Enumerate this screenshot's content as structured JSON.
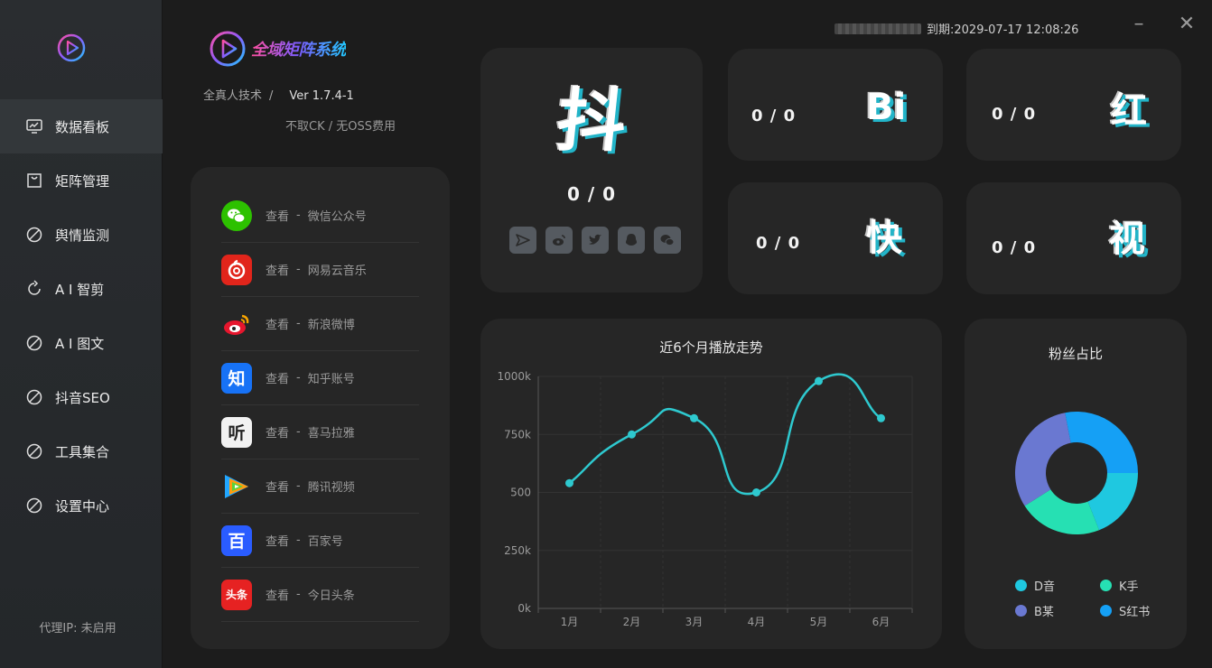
{
  "header": {
    "app_title": "全域矩阵系统",
    "breadcrumb": "全真人技术",
    "breadcrumb_sep": "/",
    "version": "Ver 1.7.4-1",
    "note": "不取CK / 无OSS费用",
    "expire": "到期:2029-07-17 12:08:26",
    "minimize": "–",
    "close": "✕"
  },
  "sidebar": {
    "items": [
      {
        "label": "数据看板",
        "icon": "monitor-chart-icon"
      },
      {
        "label": "矩阵管理",
        "icon": "shopping-bag-icon"
      },
      {
        "label": "舆情监测",
        "icon": "ban-circle-icon"
      },
      {
        "label": "A I 智剪",
        "icon": "refresh-icon"
      },
      {
        "label": "A I 图文",
        "icon": "ban-circle-icon"
      },
      {
        "label": "抖音SEO",
        "icon": "ban-circle-icon"
      },
      {
        "label": "工具集合",
        "icon": "ban-circle-icon"
      },
      {
        "label": "设置中心",
        "icon": "ban-circle-icon"
      }
    ],
    "proxy": "代理IP: 未启用"
  },
  "links": {
    "action": "查看",
    "dash": "-",
    "items": [
      {
        "name": "微信公众号",
        "icon": "wechat-icon",
        "color": "#2dc100"
      },
      {
        "name": "网易云音乐",
        "icon": "netease-music-icon",
        "color": "#e1251b"
      },
      {
        "name": "新浪微博",
        "icon": "weibo-icon",
        "color": "#262626"
      },
      {
        "name": "知乎账号",
        "icon": "zhihu-icon",
        "color": "#1772f6",
        "glyph": "知"
      },
      {
        "name": "喜马拉雅",
        "icon": "ximalaya-icon",
        "color": "#f2f2f2",
        "glyph": "听"
      },
      {
        "name": "腾讯视频",
        "icon": "tencent-video-icon",
        "color": "#262626"
      },
      {
        "name": "百家号",
        "icon": "baijiahao-icon",
        "color": "#2a5cff",
        "glyph": "百"
      },
      {
        "name": "今日头条",
        "icon": "toutiao-icon",
        "color": "#e62222",
        "glyph": "头条"
      }
    ]
  },
  "platforms": {
    "douyin": {
      "char": "抖",
      "count": "0 / 0"
    },
    "bili": {
      "char": "Bi",
      "count": "0 / 0"
    },
    "red": {
      "char": "红",
      "count": "0 / 0"
    },
    "kuai": {
      "char": "快",
      "count": "0 / 0"
    },
    "video": {
      "char": "视",
      "count": "0 / 0"
    },
    "share_icons": [
      "send-icon",
      "weibo-icon",
      "twitter-icon",
      "qq-icon",
      "wechat-icon"
    ]
  },
  "chart_data": [
    {
      "type": "line",
      "title": "近6个月播放走势",
      "categories": [
        "1月",
        "2月",
        "3月",
        "4月",
        "5月",
        "6月"
      ],
      "values": [
        540,
        750,
        820,
        500,
        980,
        820
      ],
      "y_ticks": [
        "0k",
        "250k",
        "500",
        "750k",
        "1000k"
      ],
      "ylim": [
        0,
        1000
      ],
      "grid": true,
      "color": "#2ec9cf"
    },
    {
      "type": "pie",
      "title": "粉丝占比",
      "labels": [
        "D音",
        "K手",
        "B某",
        "S红书"
      ],
      "values": [
        19,
        22,
        31,
        28
      ],
      "colors": [
        "#1fc8e0",
        "#26e0b3",
        "#6a78d1",
        "#15a0f5"
      ],
      "legend": "bottom"
    }
  ]
}
